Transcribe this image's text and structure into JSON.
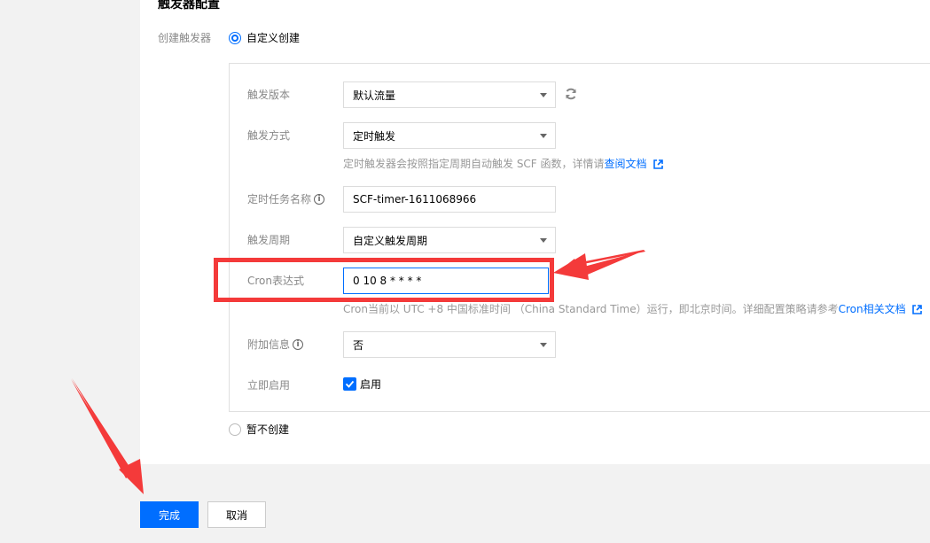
{
  "section": {
    "title": "触发器配置"
  },
  "create_trigger": {
    "label": "创建触发器",
    "option_custom": "自定义创建",
    "option_none": "暂不创建"
  },
  "form": {
    "version": {
      "label": "触发版本",
      "value": "默认流量"
    },
    "method": {
      "label": "触发方式",
      "value": "定时触发",
      "hint": "定时触发器会按照指定周期自动触发 SCF 函数，详情请",
      "hint_link": "查阅文档"
    },
    "task_name": {
      "label": "定时任务名称",
      "value": "SCF-timer-1611068966"
    },
    "period": {
      "label": "触发周期",
      "value": "自定义触发周期"
    },
    "cron": {
      "label": "Cron表达式",
      "value": "0 10 8 * * * *",
      "hint": "Cron当前以 UTC +8 中国标准时间 （China Standard Time）运行，即北京时间。详细配置策略请参考",
      "hint_link": "Cron相关文档"
    },
    "extra": {
      "label": "附加信息",
      "value": "否"
    },
    "enable_now": {
      "label": "立即启用",
      "checkbox_label": "启用",
      "checked": true
    }
  },
  "buttons": {
    "done": "完成",
    "cancel": "取消"
  },
  "colors": {
    "accent": "#006eff",
    "annotation": "#f43a3a"
  }
}
